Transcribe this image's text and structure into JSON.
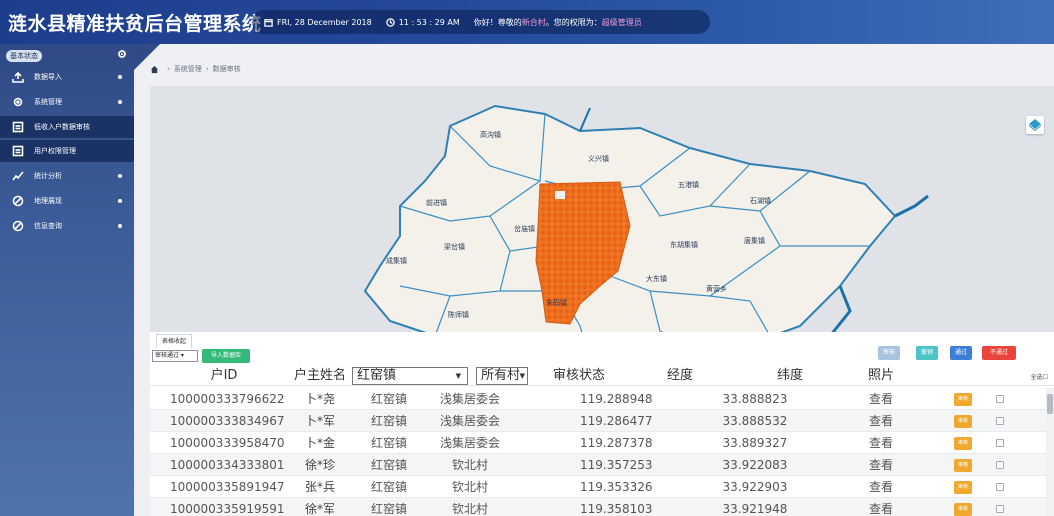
{
  "header": {
    "app_title": "涟水县精准扶贫后台管理系统",
    "date": "FRI, 28 December 2018",
    "time": "11 : 53 : 29 AM",
    "greeting_prefix": "你好！尊敬的",
    "greeting_user": "新合村",
    "greeting_mid": "。您的权限为：",
    "role": "超级管理员",
    "highlight_color": "#f29ad8"
  },
  "sidebar": {
    "header_label": "基本状态",
    "items": [
      {
        "label": "数据导入",
        "icon": "upload-icon"
      },
      {
        "label": "系统管理",
        "icon": "gear-icon"
      },
      {
        "label": "低收入户数据审核",
        "icon": "list-icon"
      },
      {
        "label": "用户权限管理",
        "icon": "list-icon"
      },
      {
        "label": "统计分析",
        "icon": "chart-line-icon"
      },
      {
        "label": "地理展现",
        "icon": "compass-icon"
      },
      {
        "label": "信息查询",
        "icon": "compass-icon"
      }
    ]
  },
  "breadcrumb": [
    "系统管理",
    "数据审核"
  ],
  "map": {
    "towns": [
      "高沟镇",
      "义兴镇",
      "五港镇",
      "石湖镇",
      "前进镇",
      "岔庙镇",
      "梁岔镇",
      "成集镇",
      "东胡集镇",
      "唐集镇",
      "大东镇",
      "黄营乡",
      "朱码镇",
      "陈师镇"
    ],
    "highlight_color": "#f07722"
  },
  "table": {
    "tab_label": "表格收起",
    "filter_value": "审核通过",
    "export_label": "导入数据库",
    "actions": [
      {
        "label": "审核",
        "color": "#a8c4df"
      },
      {
        "label": "撤销",
        "color": "#4ec3c7"
      },
      {
        "label": "通过",
        "color": "#3d7fd6"
      },
      {
        "label": "不通过",
        "color": "#e8443b"
      }
    ],
    "headers": {
      "id": "户ID",
      "name": "户主姓名",
      "town_filter": "红窑镇",
      "village_filter": "所有村",
      "status": "审核状态",
      "lng": "经度",
      "lat": "纬度",
      "photo": "照片",
      "select_all": "全选"
    },
    "rows": [
      {
        "id": "100000333796622",
        "name": "卜*尧",
        "town": "红窑镇",
        "village": "浅集居委会",
        "status": "",
        "lng": "119.288948",
        "lat": "33.888823",
        "photo": "查看",
        "btn": "审核"
      },
      {
        "id": "100000333834967",
        "name": "卜*军",
        "town": "红窑镇",
        "village": "浅集居委会",
        "status": "",
        "lng": "119.286477",
        "lat": "33.888532",
        "photo": "查看",
        "btn": "审核"
      },
      {
        "id": "100000333958470",
        "name": "卜*金",
        "town": "红窑镇",
        "village": "浅集居委会",
        "status": "",
        "lng": "119.287378",
        "lat": "33.889327",
        "photo": "查看",
        "btn": "审核"
      },
      {
        "id": "100000334333801",
        "name": "徐*珍",
        "town": "红窑镇",
        "village": "钦北村",
        "status": "",
        "lng": "119.357253",
        "lat": "33.922083",
        "photo": "查看",
        "btn": "审核"
      },
      {
        "id": "100000335891947",
        "name": "张*兵",
        "town": "红窑镇",
        "village": "钦北村",
        "status": "",
        "lng": "119.353326",
        "lat": "33.922903",
        "photo": "查看",
        "btn": "审核"
      },
      {
        "id": "100000335919591",
        "name": "徐*军",
        "town": "红窑镇",
        "village": "钦北村",
        "status": "",
        "lng": "119.358103",
        "lat": "33.921948",
        "photo": "查看",
        "btn": "审核"
      }
    ]
  }
}
